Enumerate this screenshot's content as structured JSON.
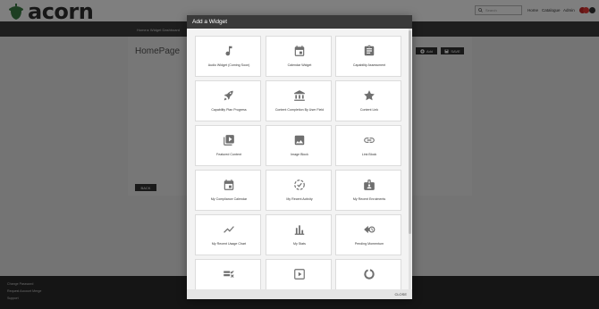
{
  "header": {
    "logo_text": "acorn",
    "search_placeholder": "Search",
    "nav": [
      "Home",
      "Catalogue",
      "Admin"
    ]
  },
  "breadcrumb": {
    "items": [
      "Home",
      "Widget Dashboard"
    ]
  },
  "page": {
    "title": "HomePage",
    "add_label": "Add",
    "save_label": "SAVE",
    "back_label": "BACK"
  },
  "footer": {
    "links": [
      "Change Password",
      "Request Account Merge",
      "Support"
    ]
  },
  "modal": {
    "title": "Add a Widget",
    "close_label": "CLOSE",
    "widgets": [
      {
        "label": "Audio Widget (Coming Soon)",
        "icon": "music-note-icon"
      },
      {
        "label": "Calendar Widget",
        "icon": "calendar-icon"
      },
      {
        "label": "Capability Assessment",
        "icon": "clipboard-icon"
      },
      {
        "label": "Capability Plan Progress",
        "icon": "rocket-icon"
      },
      {
        "label": "Content Completion By User Field",
        "icon": "bank-icon"
      },
      {
        "label": "Content Link",
        "icon": "star-icon"
      },
      {
        "label": "Featured Content",
        "icon": "photo-library-icon"
      },
      {
        "label": "Image Block",
        "icon": "image-icon"
      },
      {
        "label": "Link Block",
        "icon": "link-icon"
      },
      {
        "label": "My Compliance Calendar",
        "icon": "calendar-icon"
      },
      {
        "label": "My Recent Activity",
        "icon": "activity-circle-icon"
      },
      {
        "label": "My Recent Enrolments",
        "icon": "badge-icon"
      },
      {
        "label": "My Recent Usage Chart",
        "icon": "trend-line-icon"
      },
      {
        "label": "My Stats",
        "icon": "bar-chart-icon"
      },
      {
        "label": "Pending Momentum",
        "icon": "momentum-icon"
      },
      {
        "label": "",
        "icon": "checklist-icon"
      },
      {
        "label": "",
        "icon": "play-icon"
      },
      {
        "label": "",
        "icon": "donut-icon"
      }
    ]
  },
  "colors": {
    "header_dark": "#3c3c3c",
    "modal_header": "#3a3a3a",
    "icon_gray": "#6f6f6f",
    "logo_green": "#3a7d44",
    "notification_red": "#d93a3a"
  }
}
